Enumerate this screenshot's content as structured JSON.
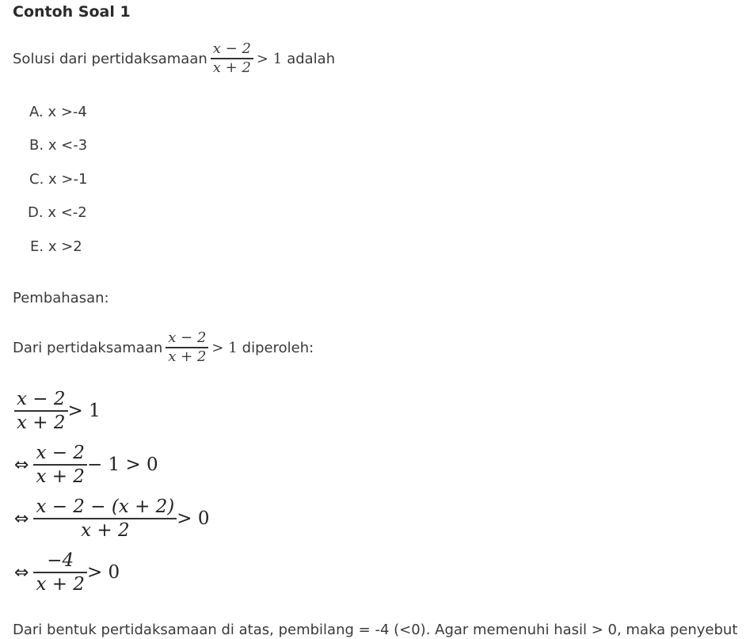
{
  "title": "Contoh Soal 1",
  "question": {
    "prefix": "Solusi dari pertidaksamaan",
    "frac_num": "x − 2",
    "frac_den": "x + 2",
    "relation": "> 1",
    "suffix": "adalah"
  },
  "options": [
    {
      "letter": "A.",
      "text": "x >-4"
    },
    {
      "letter": "B.",
      "text": "x <-3"
    },
    {
      "letter": "C.",
      "text": "x >-1"
    },
    {
      "letter": "D.",
      "text": "x <-2"
    },
    {
      "letter": "E.",
      "text": "x >2"
    }
  ],
  "discussion_label": "Pembahasan:",
  "discussion_intro": {
    "prefix": "Dari pertidaksamaan",
    "frac_num": "x − 2",
    "frac_den": "x + 2",
    "relation": "> 1",
    "suffix": "diperoleh:"
  },
  "steps": [
    {
      "iff": "",
      "num": "x − 2",
      "den": "x + 2",
      "rest": "> 1"
    },
    {
      "iff": "⇔",
      "num": "x − 2",
      "den": "x + 2",
      "rest": "− 1 > 0"
    },
    {
      "iff": "⇔",
      "num": "x − 2 − (x + 2)",
      "den": "x + 2",
      "rest": "> 0"
    },
    {
      "iff": "⇔",
      "num": "−4",
      "den": "x + 2",
      "rest": "> 0"
    }
  ],
  "conclusion": "Dari bentuk pertidaksamaan di atas, pembilang = -4 (<0). Agar memenuhi hasil > 0, maka penyebut"
}
